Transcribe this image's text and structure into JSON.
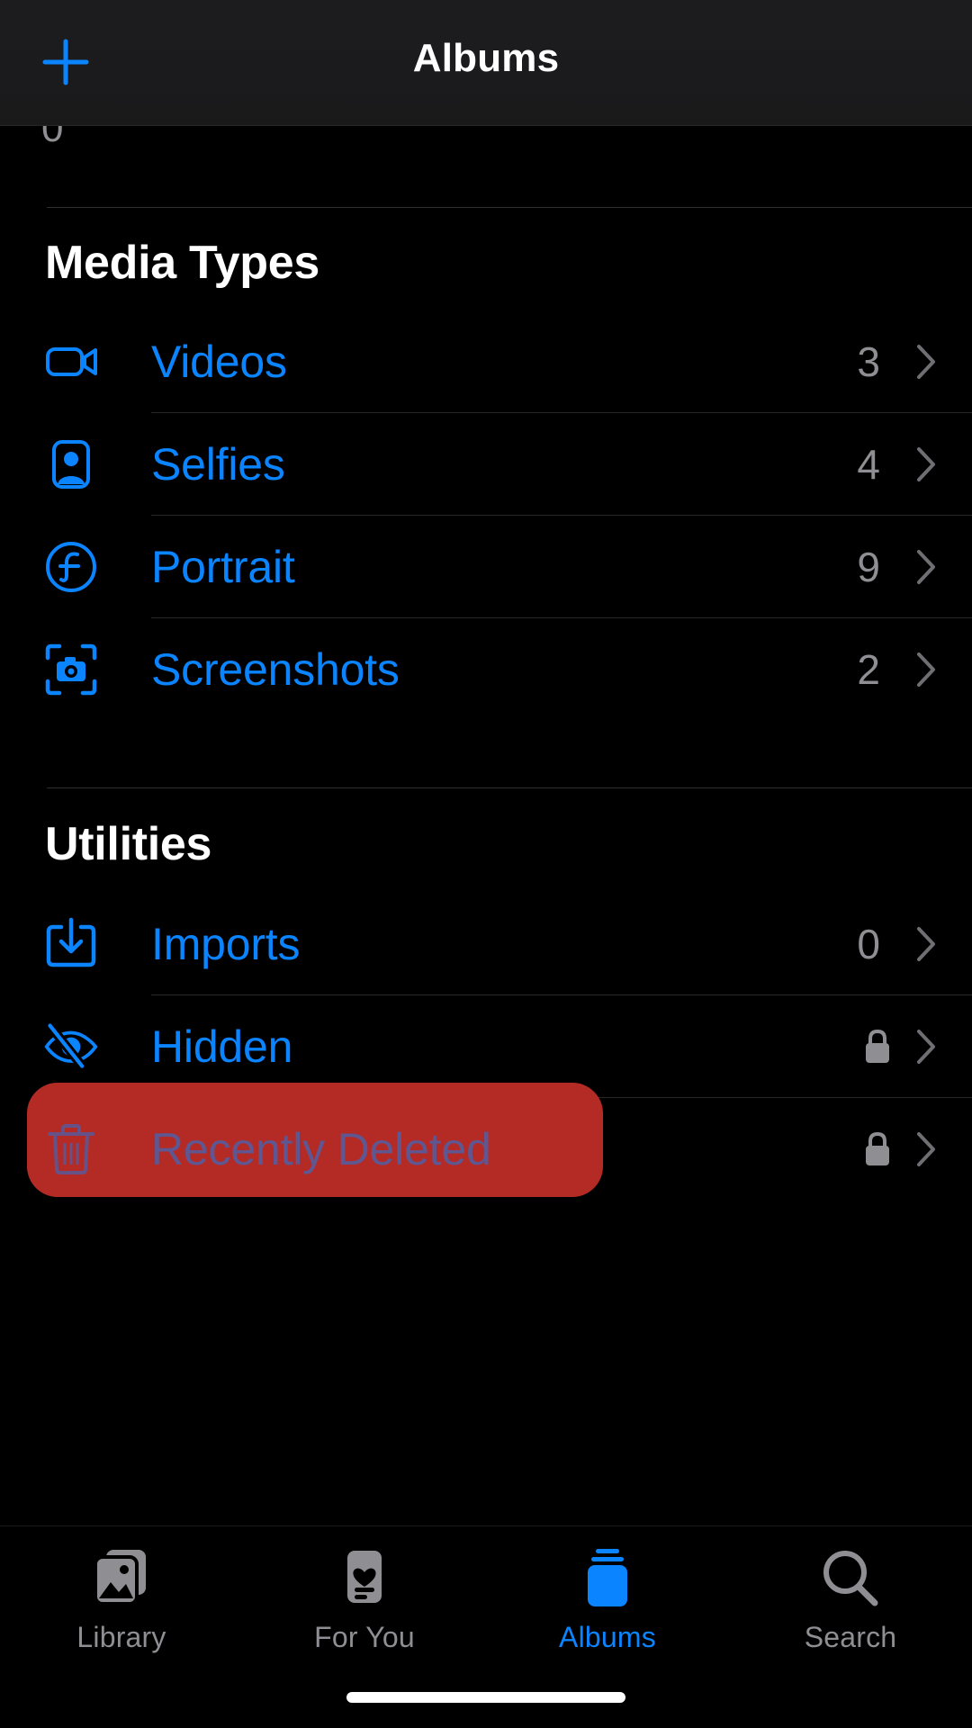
{
  "header": {
    "title": "Albums",
    "add_icon": "plus-icon"
  },
  "scroll_remnant": {
    "value": "0"
  },
  "sections": [
    {
      "title": "Media Types",
      "rows": [
        {
          "label": "Videos",
          "icon": "video-camera-icon",
          "count": "3",
          "locked": false,
          "chevron": "chevron-right-icon"
        },
        {
          "label": "Selfies",
          "icon": "person-portrait-icon",
          "count": "4",
          "locked": false,
          "chevron": "chevron-right-icon"
        },
        {
          "label": "Portrait",
          "icon": "f-aperture-circle-icon",
          "count": "9",
          "locked": false,
          "chevron": "chevron-right-icon"
        },
        {
          "label": "Screenshots",
          "icon": "camera-viewfinder-icon",
          "count": "2",
          "locked": false,
          "chevron": "chevron-right-icon"
        }
      ]
    },
    {
      "title": "Utilities",
      "rows": [
        {
          "label": "Imports",
          "icon": "square-arrow-down-icon",
          "count": "0",
          "locked": false,
          "chevron": "chevron-right-icon"
        },
        {
          "label": "Hidden",
          "icon": "eye-slash-icon",
          "count": "",
          "locked": true,
          "lock_icon": "lock-icon",
          "chevron": "chevron-right-icon"
        },
        {
          "label": "Recently Deleted",
          "icon": "trash-icon",
          "count": "",
          "locked": true,
          "lock_icon": "lock-icon",
          "chevron": "chevron-right-icon"
        }
      ]
    }
  ],
  "highlight": {
    "target": "Recently Deleted",
    "color": "#b42a25"
  },
  "tabbar": {
    "items": [
      {
        "label": "Library",
        "icon": "photo-stack-icon",
        "active": false
      },
      {
        "label": "For You",
        "icon": "heart-card-icon",
        "active": false
      },
      {
        "label": "Albums",
        "icon": "albums-stack-icon",
        "active": true
      },
      {
        "label": "Search",
        "icon": "magnifier-icon",
        "active": false
      }
    ]
  },
  "colors": {
    "accent": "#0a84ff",
    "secondary_text": "#8e8e93",
    "background": "#000000",
    "nav_background": "#1c1c1e",
    "highlight_red": "#b42a25"
  }
}
